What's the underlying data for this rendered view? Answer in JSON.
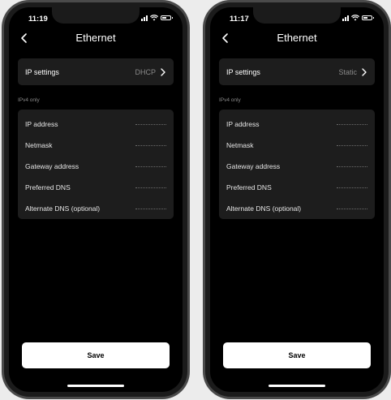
{
  "screens": [
    {
      "status_time": "11:19",
      "title": "Ethernet",
      "ip_settings_label": "IP settings",
      "ip_settings_value": "DHCP",
      "section_label": "IPv4 only",
      "fields": [
        {
          "label": "IP address"
        },
        {
          "label": "Netmask"
        },
        {
          "label": "Gateway address"
        },
        {
          "label": "Preferred DNS"
        },
        {
          "label": "Alternate DNS (optional)"
        }
      ],
      "save_label": "Save"
    },
    {
      "status_time": "11:17",
      "title": "Ethernet",
      "ip_settings_label": "IP settings",
      "ip_settings_value": "Static",
      "section_label": "IPv4 only",
      "fields": [
        {
          "label": "IP address"
        },
        {
          "label": "Netmask"
        },
        {
          "label": "Gateway address"
        },
        {
          "label": "Preferred DNS"
        },
        {
          "label": "Alternate DNS (optional)"
        }
      ],
      "save_label": "Save"
    }
  ],
  "icons": {
    "back": "chevron-left-icon",
    "ip_settings_arrow": "chevron-right-icon",
    "status": [
      "signal-icon",
      "wifi-icon",
      "battery-icon"
    ]
  },
  "colors": {
    "background": "#000000",
    "card": "#1d1d1d",
    "muted_text": "#8a8a8a",
    "save_button": "#ffffff"
  }
}
